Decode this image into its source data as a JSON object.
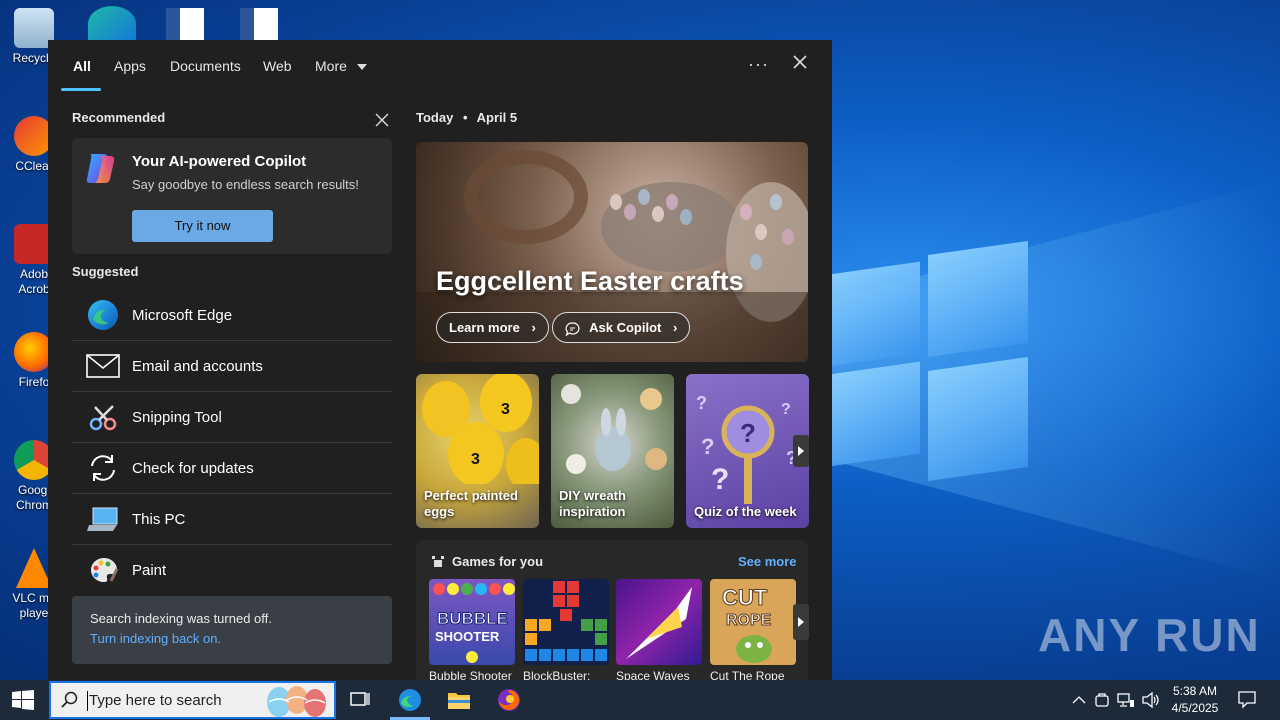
{
  "desktop": {
    "icons": [
      {
        "label": "Recycle"
      },
      {
        "label": "CClear"
      },
      {
        "label": "Adob Acrob"
      },
      {
        "label": "Firefo"
      },
      {
        "label": "Googl Chrom"
      },
      {
        "label": "VLC me playe"
      }
    ],
    "watermark": "ANY RUN"
  },
  "panel": {
    "tabs": [
      {
        "label": "All"
      },
      {
        "label": "Apps"
      },
      {
        "label": "Documents"
      },
      {
        "label": "Web"
      },
      {
        "label": "More"
      }
    ],
    "more_options_label": "···",
    "recommended": {
      "title": "Recommended",
      "copilot": {
        "title": "Your AI-powered Copilot",
        "subtitle": "Say goodbye to endless search results!",
        "button": "Try it now"
      }
    },
    "suggested": {
      "title": "Suggested",
      "items": [
        {
          "label": "Microsoft Edge",
          "icon": "edge-icon"
        },
        {
          "label": "Email and accounts",
          "icon": "mail-icon"
        },
        {
          "label": "Snipping Tool",
          "icon": "snipping-tool-icon"
        },
        {
          "label": "Check for updates",
          "icon": "refresh-icon"
        },
        {
          "label": "This PC",
          "icon": "computer-icon"
        },
        {
          "label": "Paint",
          "icon": "paint-palette-icon"
        }
      ]
    },
    "indexing": {
      "text": "Search indexing was turned off.",
      "link": "Turn indexing back on."
    },
    "today": {
      "label": "Today",
      "separator": "•",
      "date": "April 5"
    },
    "hero": {
      "title": "Eggcellent Easter crafts",
      "learn_more": "Learn more",
      "ask_copilot": "Ask Copilot"
    },
    "tiles": [
      {
        "label": "Perfect painted eggs"
      },
      {
        "label": "DIY wreath inspiration"
      },
      {
        "label": "Quiz of the week"
      }
    ],
    "games": {
      "title": "Games for you",
      "see_more": "See more",
      "items": [
        {
          "name": "Bubble Shooter"
        },
        {
          "name": "BlockBuster:"
        },
        {
          "name": "Space Waves"
        },
        {
          "name": "Cut The Rope"
        }
      ]
    }
  },
  "taskbar": {
    "search_placeholder": "Type here to search",
    "time": "5:38 AM",
    "date": "4/5/2025"
  },
  "colors": {
    "accent": "#4cc2ff",
    "link": "#60b0ff",
    "panel_bg": "#202020",
    "taskbar_bg": "#1c2a3a"
  }
}
